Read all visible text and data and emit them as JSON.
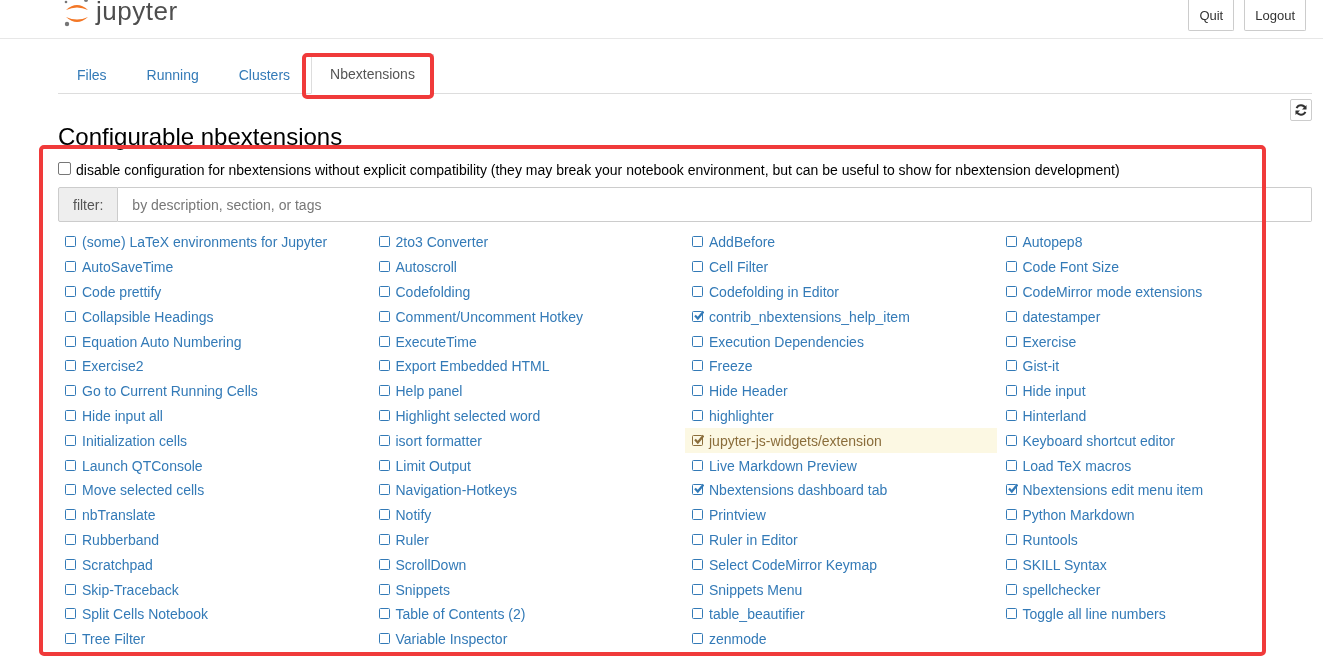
{
  "header": {
    "logo_text": "jupyter",
    "buttons": [
      "Quit",
      "Logout"
    ]
  },
  "tabs": [
    {
      "label": "Files",
      "selected": false
    },
    {
      "label": "Running",
      "selected": false
    },
    {
      "label": "Clusters",
      "selected": false
    },
    {
      "label": "Nbextensions",
      "selected": true
    }
  ],
  "page": {
    "title": "Configurable nbextensions",
    "compat_option": {
      "label": "disable configuration for nbextensions without explicit compatibility (they may break your notebook environment, but can be useful to show for nbextension development)",
      "checked": false
    },
    "filter": {
      "label": "filter:",
      "placeholder": "by description, section, or tags"
    }
  },
  "extensions": [
    {
      "name": "(some) LaTeX environments for Jupyter",
      "checked": false,
      "selected": false
    },
    {
      "name": "2to3 Converter",
      "checked": false,
      "selected": false
    },
    {
      "name": "AddBefore",
      "checked": false,
      "selected": false
    },
    {
      "name": "Autopep8",
      "checked": false,
      "selected": false
    },
    {
      "name": "AutoSaveTime",
      "checked": false,
      "selected": false
    },
    {
      "name": "Autoscroll",
      "checked": false,
      "selected": false
    },
    {
      "name": "Cell Filter",
      "checked": false,
      "selected": false
    },
    {
      "name": "Code Font Size",
      "checked": false,
      "selected": false
    },
    {
      "name": "Code prettify",
      "checked": false,
      "selected": false
    },
    {
      "name": "Codefolding",
      "checked": false,
      "selected": false
    },
    {
      "name": "Codefolding in Editor",
      "checked": false,
      "selected": false
    },
    {
      "name": "CodeMirror mode extensions",
      "checked": false,
      "selected": false
    },
    {
      "name": "Collapsible Headings",
      "checked": false,
      "selected": false
    },
    {
      "name": "Comment/Uncomment Hotkey",
      "checked": false,
      "selected": false
    },
    {
      "name": "contrib_nbextensions_help_item",
      "checked": true,
      "selected": false
    },
    {
      "name": "datestamper",
      "checked": false,
      "selected": false
    },
    {
      "name": "Equation Auto Numbering",
      "checked": false,
      "selected": false
    },
    {
      "name": "ExecuteTime",
      "checked": false,
      "selected": false
    },
    {
      "name": "Execution Dependencies",
      "checked": false,
      "selected": false
    },
    {
      "name": "Exercise",
      "checked": false,
      "selected": false
    },
    {
      "name": "Exercise2",
      "checked": false,
      "selected": false
    },
    {
      "name": "Export Embedded HTML",
      "checked": false,
      "selected": false
    },
    {
      "name": "Freeze",
      "checked": false,
      "selected": false
    },
    {
      "name": "Gist-it",
      "checked": false,
      "selected": false
    },
    {
      "name": "Go to Current Running Cells",
      "checked": false,
      "selected": false
    },
    {
      "name": "Help panel",
      "checked": false,
      "selected": false
    },
    {
      "name": "Hide Header",
      "checked": false,
      "selected": false
    },
    {
      "name": "Hide input",
      "checked": false,
      "selected": false
    },
    {
      "name": "Hide input all",
      "checked": false,
      "selected": false
    },
    {
      "name": "Highlight selected word",
      "checked": false,
      "selected": false
    },
    {
      "name": "highlighter",
      "checked": false,
      "selected": false
    },
    {
      "name": "Hinterland",
      "checked": false,
      "selected": false
    },
    {
      "name": "Initialization cells",
      "checked": false,
      "selected": false
    },
    {
      "name": "isort formatter",
      "checked": false,
      "selected": false
    },
    {
      "name": "jupyter-js-widgets/extension",
      "checked": true,
      "selected": true
    },
    {
      "name": "Keyboard shortcut editor",
      "checked": false,
      "selected": false
    },
    {
      "name": "Launch QTConsole",
      "checked": false,
      "selected": false
    },
    {
      "name": "Limit Output",
      "checked": false,
      "selected": false
    },
    {
      "name": "Live Markdown Preview",
      "checked": false,
      "selected": false
    },
    {
      "name": "Load TeX macros",
      "checked": false,
      "selected": false
    },
    {
      "name": "Move selected cells",
      "checked": false,
      "selected": false
    },
    {
      "name": "Navigation-Hotkeys",
      "checked": false,
      "selected": false
    },
    {
      "name": "Nbextensions dashboard tab",
      "checked": true,
      "selected": false
    },
    {
      "name": "Nbextensions edit menu item",
      "checked": true,
      "selected": false
    },
    {
      "name": "nbTranslate",
      "checked": false,
      "selected": false
    },
    {
      "name": "Notify",
      "checked": false,
      "selected": false
    },
    {
      "name": "Printview",
      "checked": false,
      "selected": false
    },
    {
      "name": "Python Markdown",
      "checked": false,
      "selected": false
    },
    {
      "name": "Rubberband",
      "checked": false,
      "selected": false
    },
    {
      "name": "Ruler",
      "checked": false,
      "selected": false
    },
    {
      "name": "Ruler in Editor",
      "checked": false,
      "selected": false
    },
    {
      "name": "Runtools",
      "checked": false,
      "selected": false
    },
    {
      "name": "Scratchpad",
      "checked": false,
      "selected": false
    },
    {
      "name": "ScrollDown",
      "checked": false,
      "selected": false
    },
    {
      "name": "Select CodeMirror Keymap",
      "checked": false,
      "selected": false
    },
    {
      "name": "SKILL Syntax",
      "checked": false,
      "selected": false
    },
    {
      "name": "Skip-Traceback",
      "checked": false,
      "selected": false
    },
    {
      "name": "Snippets",
      "checked": false,
      "selected": false
    },
    {
      "name": "Snippets Menu",
      "checked": false,
      "selected": false
    },
    {
      "name": "spellchecker",
      "checked": false,
      "selected": false
    },
    {
      "name": "Split Cells Notebook",
      "checked": false,
      "selected": false
    },
    {
      "name": "Table of Contents (2)",
      "checked": false,
      "selected": false
    },
    {
      "name": "table_beautifier",
      "checked": false,
      "selected": false
    },
    {
      "name": "Toggle all line numbers",
      "checked": false,
      "selected": false
    },
    {
      "name": "Tree Filter",
      "checked": false,
      "selected": false
    },
    {
      "name": "Variable Inspector",
      "checked": false,
      "selected": false
    },
    {
      "name": "zenmode",
      "checked": false,
      "selected": false
    }
  ]
}
